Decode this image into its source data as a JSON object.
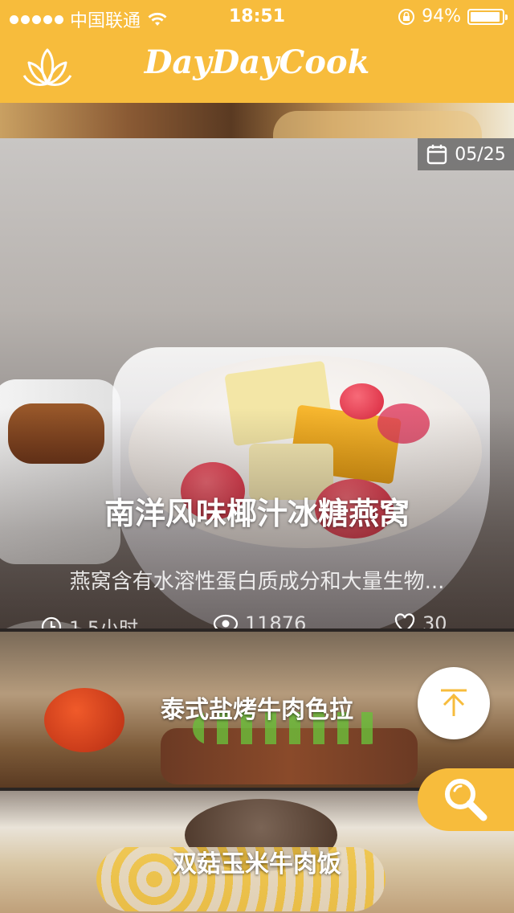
{
  "status_bar": {
    "carrier": "中国联通",
    "time": "18:51",
    "battery_percent": "94%",
    "battery_level": 0.94
  },
  "nav": {
    "brand": "DayDayCook"
  },
  "featured": {
    "date": "05/25",
    "title": "南洋风味椰汁冰糖燕窝",
    "description": "燕窝含有水溶性蛋白质成分和大量生物...",
    "time": "1.5小时",
    "views": "11876",
    "likes": "30"
  },
  "recipes": [
    {
      "title": "泰式盐烤牛肉色拉"
    },
    {
      "title": "双菇玉米牛肉饭"
    }
  ],
  "colors": {
    "accent": "#f7bc3c"
  },
  "icons": {
    "logo": "lotus-icon",
    "date": "calendar-icon",
    "time": "clock-icon",
    "views": "eye-icon",
    "likes": "heart-icon",
    "back_to_top": "arrow-up-icon",
    "search": "search-icon"
  }
}
